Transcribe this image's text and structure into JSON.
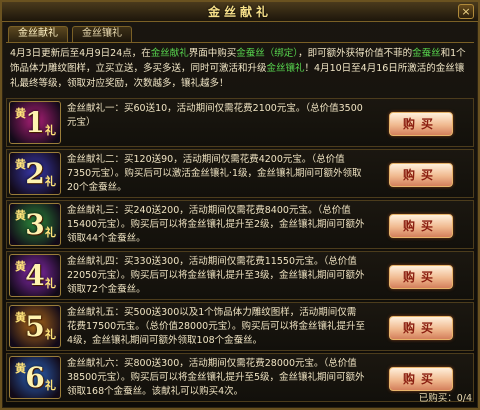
{
  "window": {
    "title": "金丝献礼",
    "close": "×"
  },
  "tabs": [
    {
      "label": "金丝献礼",
      "active": true
    },
    {
      "label": "金丝镶礼",
      "active": false
    }
  ],
  "notice": {
    "line1_pre": "4月3日更新后至4月9日24点，在",
    "line1_hl1": "金丝献礼",
    "line1_mid": "界面中购买",
    "line1_hl2": "金蚕丝（绑定）",
    "line1_post": "，即可额外获得价值不菲的",
    "line2_hl1": "金蚕丝",
    "line2_mid": "和1个饰品体力雕纹图样，立买立送，多买多送，同时可激活和升级",
    "line2_hl2": "金丝镶礼",
    "line2_post": "！4月10日至",
    "line3": "4月16日所激活的金丝镶礼最终等级，领取对应奖励，次数越多，镶礼越多！"
  },
  "rows": [
    {
      "num": "1",
      "text": "金丝献礼一：买60送10，活动期间仅需花费2100元宝。（总价值3500元宝）",
      "button": "购买"
    },
    {
      "num": "2",
      "text": "金丝献礼二：买120送90，活动期间仅需花费4200元宝。（总价值7350元宝）。购买后可以激活金丝镶礼·1级，金丝镶礼期间可额外领取20个金蚕丝。",
      "button": "购买"
    },
    {
      "num": "3",
      "text": "金丝献礼三：买240送200，活动期间仅需花费8400元宝。（总价值15400元宝）。购买后可以将金丝镶礼提升至2级，金丝镶礼期间可额外领取44个金蚕丝。",
      "button": "购买"
    },
    {
      "num": "4",
      "text": "金丝献礼四：买330送300，活动期间仅需花费11550元宝。（总价值22050元宝）。购买后可以将金丝镶礼提升至3级，金丝镶礼期间可额外领取72个金蚕丝。",
      "button": "购买"
    },
    {
      "num": "5",
      "text": "金丝献礼五：买500送300以及1个饰品体力雕纹图样，活动期间仅需花费17500元宝。（总价值28000元宝）。购买后可以将金丝镶礼提升至4级，金丝镶礼期间可额外领取108个金蚕丝。",
      "button": "购买"
    },
    {
      "num": "6",
      "text": "金丝献礼六：买800送300，活动期间仅需花费28000元宝。（总价值38500元宝）。购买后可以将金丝镶礼提升至5级，金丝镶礼期间可额外领取168个金蚕丝。该献礼可以购买4次。",
      "button": "购买"
    }
  ],
  "gift_char_top": "礼",
  "gift_char_side": "黄",
  "bought": {
    "label": "已购买：",
    "value": "0/4"
  },
  "colors": {
    "highlight_green": "#57d44e",
    "badge_backgrounds": [
      "#b0207a",
      "#3a3ab0",
      "#2b8a3a",
      "#8a2bb0",
      "#b06a1a",
      "#2d66c0"
    ]
  }
}
